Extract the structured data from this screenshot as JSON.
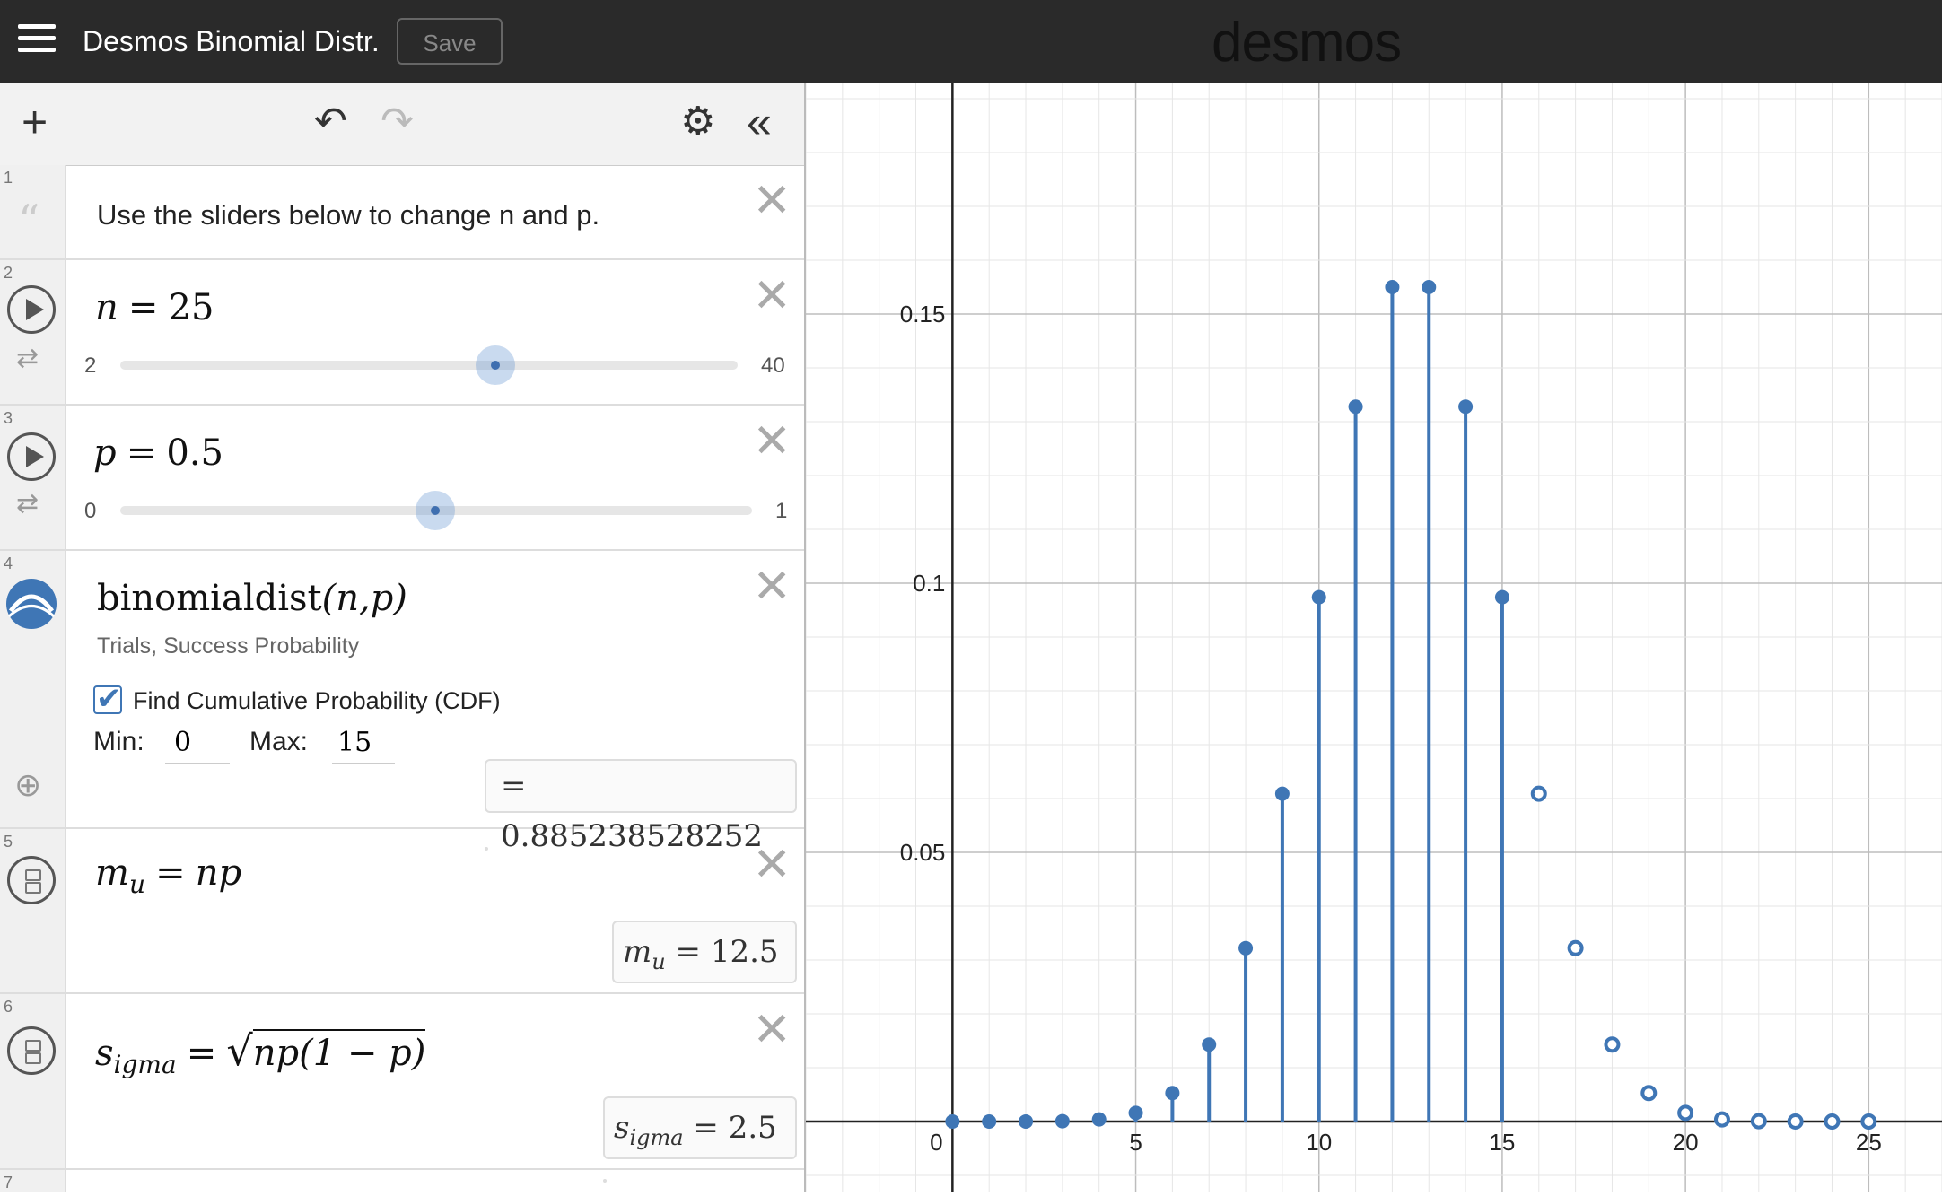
{
  "topbar": {
    "title": "Desmos Binomial Distr.",
    "save_label": "Save",
    "brand": "desmos"
  },
  "expressions": {
    "note": {
      "index": "1",
      "text": "Use the sliders below to change n and p."
    },
    "n": {
      "index": "2",
      "var": "n",
      "eq": "=",
      "value": "25",
      "min": "2",
      "max": "40",
      "fraction": 0.605
    },
    "p": {
      "index": "3",
      "var": "p",
      "eq": "=",
      "value": "0.5",
      "min": "0",
      "max": "1",
      "fraction": 0.5
    },
    "binom": {
      "index": "4",
      "func": "binomialdist",
      "args": "(n,p)",
      "hint1": "Trials,",
      "hint2": "Success Probability",
      "cdf_label": "Find Cumulative Probability (CDF)",
      "min_label": "Min:",
      "min_value": "0",
      "max_label": "Max:",
      "max_value": "15",
      "result": "= 0.885238528252"
    },
    "mu": {
      "index": "5",
      "lhs": "m",
      "sub": "u",
      "eq": "=",
      "rhs": "np",
      "eval_eq": "=",
      "eval_value": "12.5"
    },
    "sigma": {
      "index": "6",
      "lhs": "s",
      "sub": "igma",
      "eq": "=",
      "rhs": "np(1 − p)",
      "eval_eq": "=",
      "eval_value": "2.5"
    },
    "next": {
      "index": "7"
    }
  },
  "chart_data": {
    "type": "scatter",
    "x": [
      0,
      1,
      2,
      3,
      4,
      5,
      6,
      7,
      8,
      9,
      10,
      11,
      12,
      13,
      14,
      15,
      16,
      17,
      18,
      19,
      20,
      21,
      22,
      23,
      24,
      25
    ],
    "y": [
      3e-08,
      7e-07,
      9e-06,
      7e-05,
      0.0004,
      0.0016,
      0.0053,
      0.0143,
      0.0322,
      0.0609,
      0.0974,
      0.1328,
      0.155,
      0.155,
      0.1328,
      0.0974,
      0.0609,
      0.0322,
      0.0143,
      0.0053,
      0.0016,
      0.0004,
      7e-05,
      9e-06,
      7e-07,
      3e-08
    ],
    "stems_x_max": 15,
    "xlim": [
      -4,
      27
    ],
    "ylim": [
      -0.013,
      0.193
    ],
    "x_ticks": [
      "0",
      "5",
      "10",
      "15",
      "20",
      "25"
    ],
    "y_ticks": [
      "0.05",
      "0.1",
      "0.15"
    ],
    "grid": true,
    "color": "#3f76b5"
  }
}
